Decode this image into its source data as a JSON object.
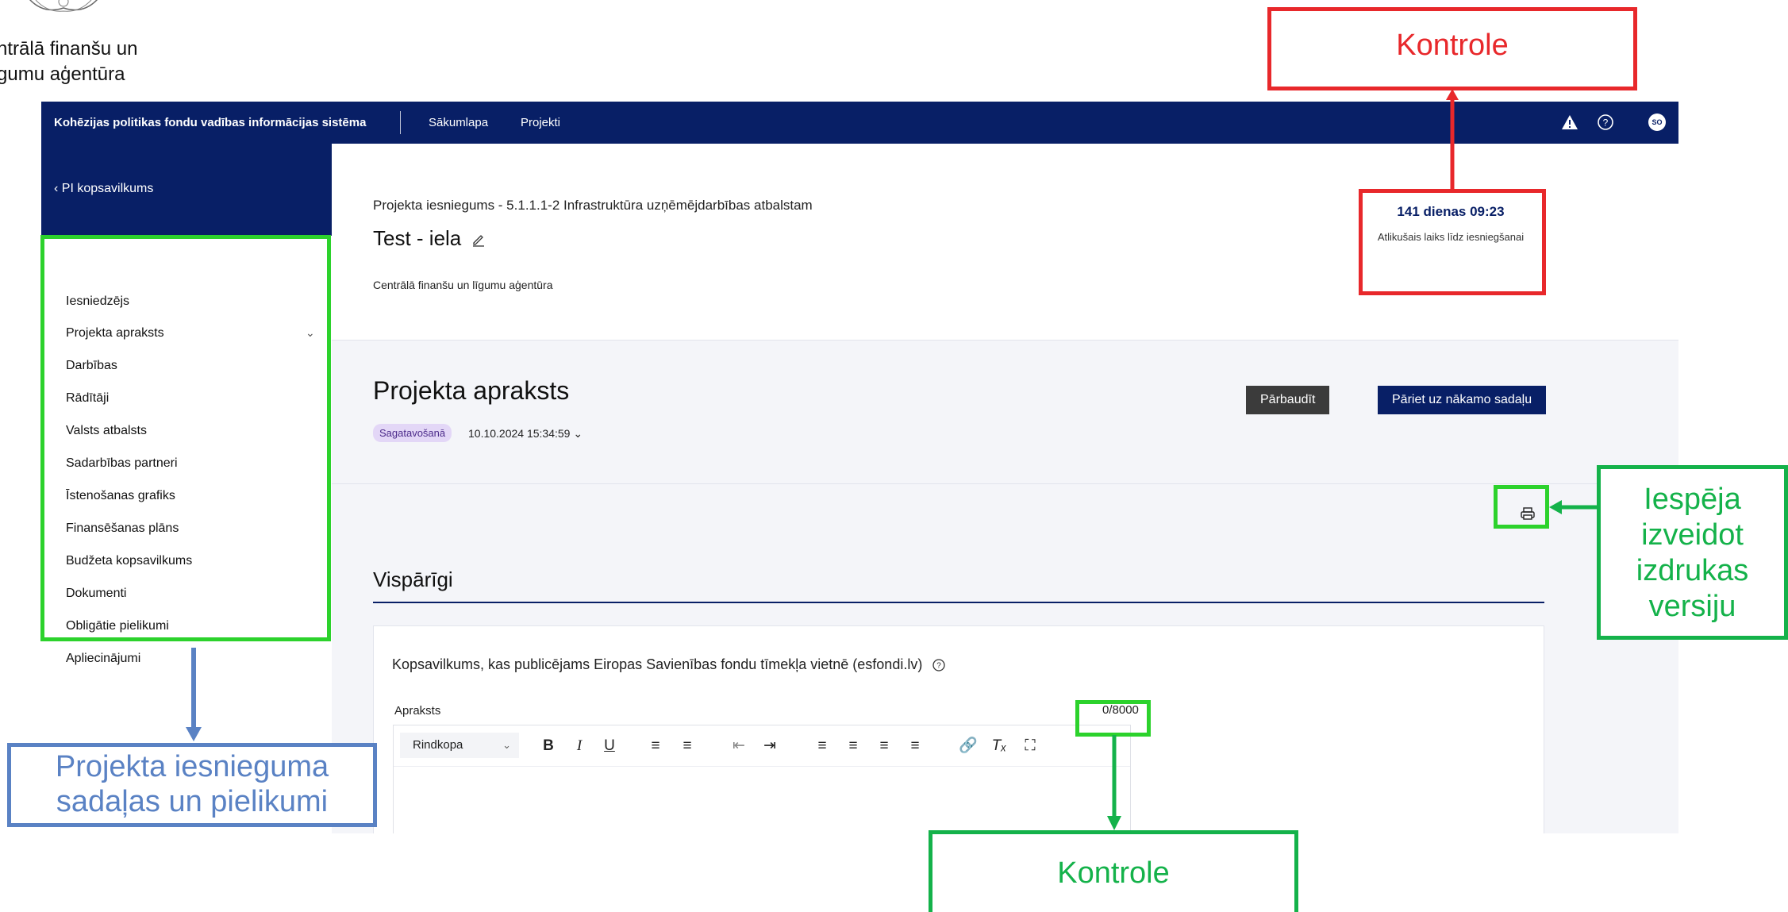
{
  "logo": {
    "line1": "ntrālā finanšu un",
    "line2": "gumu aģentūra"
  },
  "topbar": {
    "brand": "Kohēzijas politikas fondu vadības informācijas sistēma",
    "nav_home": "Sākumlapa",
    "nav_projects": "Projekti",
    "avatar": "SO"
  },
  "sidebar": {
    "back_label": "PI kopsavilkums",
    "items": [
      {
        "label": "Iesniedzējs"
      },
      {
        "label": "Projekta apraksts"
      },
      {
        "label": "Darbības"
      },
      {
        "label": "Rādītāji"
      },
      {
        "label": "Valsts atbalsts"
      },
      {
        "label": "Sadarbības partneri"
      },
      {
        "label": "Īstenošanas grafiks"
      },
      {
        "label": "Finansēšanas plāns"
      },
      {
        "label": "Budžeta kopsavilkums"
      },
      {
        "label": "Dokumenti"
      },
      {
        "label": "Obligātie pielikumi"
      },
      {
        "label": "Apliecinājumi"
      }
    ]
  },
  "project": {
    "subtitle": "Projekta iesniegums - 5.1.1.1-2 Infrastruktūra uzņēmējdarbības atbalstam",
    "title": "Test - iela",
    "organization": "Centrālā finanšu un līgumu aģentūra",
    "timer_value": "141 dienas 09:23",
    "timer_caption": "Atlikušais laiks līdz iesniegšanai"
  },
  "section": {
    "title": "Projekta apraksts",
    "status_badge": "Sagatavošanā",
    "datetime": "10.10.2024 15:34:59",
    "btn_check": "Pārbaudīt",
    "btn_next": "Pāriet uz nākamo sadaļu"
  },
  "general": {
    "title": "Vispārīgi",
    "summary_label": "Kopsavilkums, kas publicējams Eiropas Savienības fondu tīmekļa vietnē (esfondi.lv)",
    "field_label": "Apraksts",
    "counter": "0/8000",
    "format_select": "Rindkopa"
  },
  "toolbar_icons": [
    "bold-icon",
    "italic-icon",
    "underline-icon",
    "ordered-list-icon",
    "bullet-list-icon",
    "outdent-icon",
    "indent-icon",
    "align-left-icon",
    "align-center-icon",
    "align-right-icon",
    "align-justify-icon",
    "link-icon",
    "clear-format-icon",
    "fullscreen-icon"
  ],
  "annotations": {
    "kontrole_top": "Kontrole",
    "kontrole_bottom": "Kontrole",
    "print_l1": "Iespēja",
    "print_l2": "izveidot",
    "print_l3": "izdrukas",
    "print_l4": "versiju",
    "sections_l1": "Projekta iesnieguma",
    "sections_l2": "sadaļas un pielikumi",
    "colors": {
      "red": "#e8282b",
      "green": "#2cd22c",
      "green_dark": "#14b24a",
      "blue": "#5a82c4",
      "navy": "#081f66"
    }
  }
}
